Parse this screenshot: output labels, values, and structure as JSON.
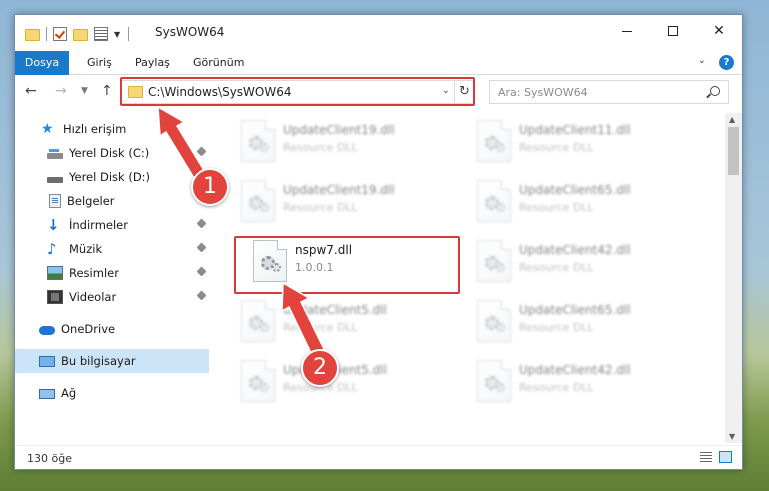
{
  "window": {
    "title": "SysWOW64",
    "ribbon_tabs": [
      "Dosya",
      "Giriş",
      "Paylaş",
      "Görünüm"
    ],
    "help_label": "?"
  },
  "address": {
    "path": "C:\\Windows\\SysWOW64",
    "search_placeholder": "Ara: SysWOW64"
  },
  "sidebar": {
    "items": [
      {
        "label": "Hızlı erişim",
        "icon": "star-icon",
        "pinned": false
      },
      {
        "label": "Yerel Disk (C:)",
        "icon": "drive-icon",
        "pinned": true
      },
      {
        "label": "Yerel Disk (D:)",
        "icon": "drive-icon",
        "pinned": true
      },
      {
        "label": "Belgeler",
        "icon": "documents-icon",
        "pinned": true
      },
      {
        "label": "İndirmeler",
        "icon": "download-icon",
        "pinned": true
      },
      {
        "label": "Müzik",
        "icon": "music-icon",
        "pinned": true
      },
      {
        "label": "Resimler",
        "icon": "pictures-icon",
        "pinned": true
      },
      {
        "label": "Videolar",
        "icon": "videos-icon",
        "pinned": true
      },
      {
        "label": "OneDrive",
        "icon": "onedrive-icon",
        "pinned": false
      },
      {
        "label": "Bu bilgisayar",
        "icon": "this-pc-icon",
        "pinned": false,
        "selected": true
      },
      {
        "label": "Ağ",
        "icon": "network-icon",
        "pinned": false
      }
    ]
  },
  "files": [
    {
      "name": "UpdateClient19.dll",
      "sub": "Resource DLL"
    },
    {
      "name": "UpdateClient11.dll",
      "sub": "Resource DLL"
    },
    {
      "name": "UpdateClient19.dll",
      "sub": "Resource DLL"
    },
    {
      "name": "UpdateClient65.dll",
      "sub": "Resource DLL"
    },
    {
      "name": "nspw7.dll",
      "sub": "1.0.0.1"
    },
    {
      "name": "UpdateClient42.dll",
      "sub": "Resource DLL"
    },
    {
      "name": "UpdateClient5.dll",
      "sub": "Resource DLL"
    },
    {
      "name": "UpdateClient65.dll",
      "sub": "Resource DLL"
    },
    {
      "name": "UpdateClient5.dll",
      "sub": "Resource DLL"
    },
    {
      "name": "UpdateClient42.dll",
      "sub": "Resource DLL"
    }
  ],
  "status": {
    "item_count": "130 öğe"
  },
  "callouts": [
    "1",
    "2"
  ],
  "colors": {
    "accent": "#1979ca",
    "highlight": "#d9393c",
    "callout": "#e2433d",
    "selected_bg": "#cce4f7"
  }
}
